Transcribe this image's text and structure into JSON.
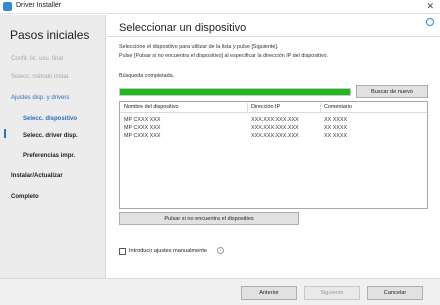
{
  "window": {
    "title": "Driver Installer"
  },
  "sidebar": {
    "heading": "Pasos iniciales",
    "steps": [
      {
        "label": "Confir. lic. usu. final"
      },
      {
        "label": "Selecc. método instal."
      },
      {
        "label": "Ajustes disp. y drivers"
      },
      {
        "label": "Selecc. dispositivo"
      },
      {
        "label": "Selecc. driver disp."
      },
      {
        "label": "Preferencias impr."
      },
      {
        "label": "Instalar/Actualizar"
      },
      {
        "label": "Completo"
      }
    ]
  },
  "main": {
    "title": "Seleccionar un dispositivo",
    "instruction_1": "Seleccione el dispositivo para utilizar de la lista y pulse [Siguiente].",
    "instruction_2": "Pulse [Pulsar si no encuentra el dispositivo] al especificar la dirección IP del dispositivo.",
    "status": "Búsqueda completada.",
    "progress_percent": 100,
    "progress_color": "#1fb81f",
    "search_again_label": "Buscar de nuevo",
    "table": {
      "headers": [
        "Nombre del dispositivo",
        "Dirección IP",
        "Comentario"
      ],
      "rows": [
        [
          "MP CXXX XXX",
          "XXX.XXX.XXX.XXX",
          "XX XXXX"
        ],
        [
          "MP CXXX XXX",
          "XXX.XXX.XXX.XXX",
          "XX XXXX"
        ],
        [
          "MP CXXX XXX",
          "XXX.XXX.XXX.XXX",
          "XX XXXX"
        ]
      ]
    },
    "not_found_label": "Pulsar si no encuentra el dispositivo",
    "manual_settings_label": "Introducir ajustes manualmente"
  },
  "footer": {
    "back_label": "Anterior",
    "next_label": "Siguiente",
    "cancel_label": "Cancelar"
  }
}
